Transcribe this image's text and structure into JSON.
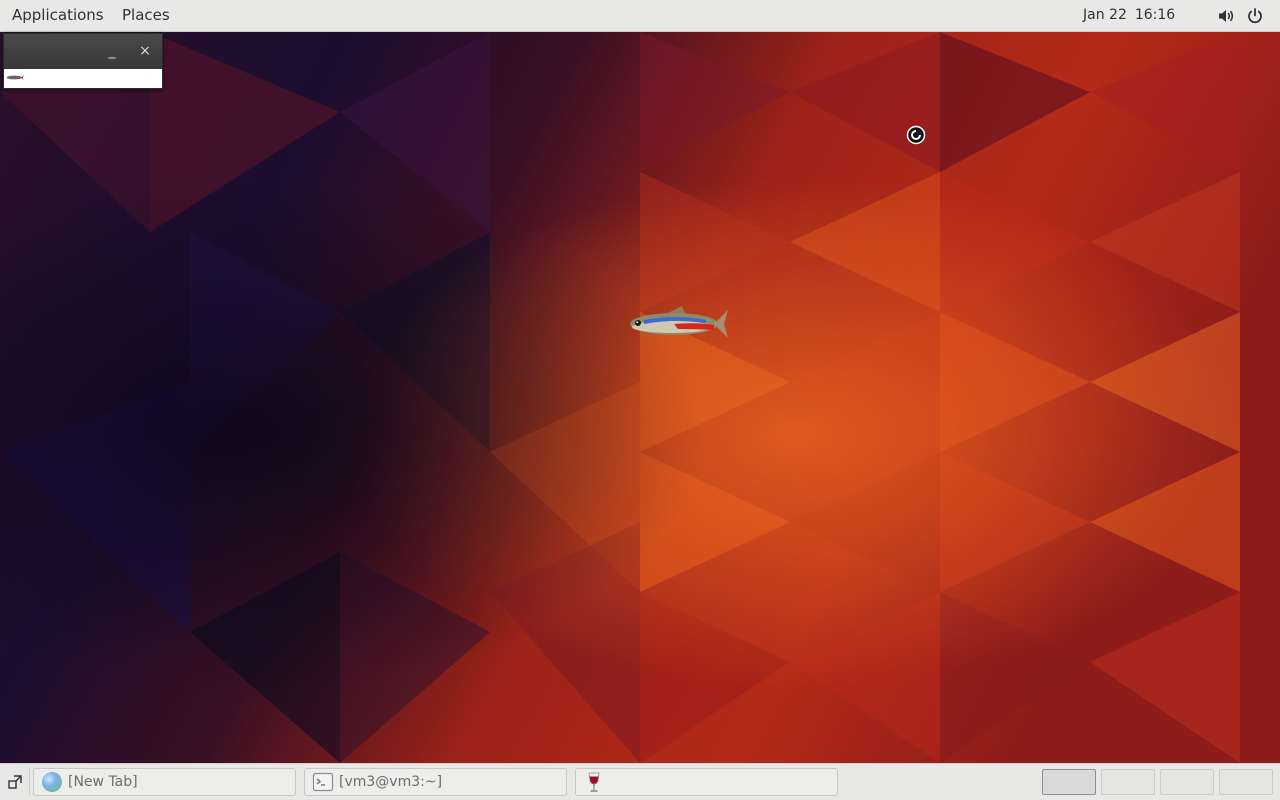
{
  "top_panel": {
    "applications_label": "Applications",
    "places_label": "Places",
    "clock": {
      "date": "Jan 22",
      "time": "16:16"
    },
    "tray_icons": [
      "volume-icon",
      "power-icon"
    ]
  },
  "desktop": {
    "mini_window": {
      "minimize_glyph": "_",
      "close_glyph": "×",
      "content_icon": "fish-icon"
    },
    "desktop_fish_icon": "fish-icon",
    "cursor_icon": "busy-cursor-icon"
  },
  "taskbar": {
    "tasks": [
      {
        "label": "[New Tab]",
        "icon": "browser-globe-icon",
        "active": false
      },
      {
        "label": "[vm3@vm3:~]",
        "icon": "terminal-icon",
        "active": false
      },
      {
        "label": "",
        "icon": "wine-glass-icon",
        "active": false
      }
    ],
    "workspaces": [
      {
        "index": 1,
        "active": true
      },
      {
        "index": 2,
        "active": false
      },
      {
        "index": 3,
        "active": false
      },
      {
        "index": 4,
        "active": false
      }
    ]
  },
  "colors": {
    "panel_bg": "#e8e8e7",
    "wallpaper_dark": "#1a0c1e",
    "wallpaper_red": "#b2261a",
    "wallpaper_orange": "#e2561c"
  }
}
